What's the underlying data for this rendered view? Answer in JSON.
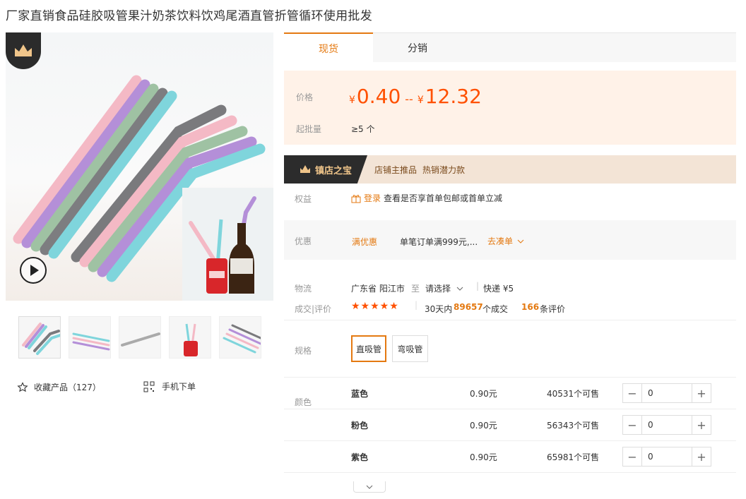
{
  "title": "厂家直销食品硅胶吸管果汁奶茶饮料饮鸡尾酒直管折管循环使用批发",
  "gallery": {
    "favorite_label": "收藏产品（127）",
    "mobile_label": "手机下单"
  },
  "tabs": [
    "现货",
    "分销"
  ],
  "price": {
    "label": "价格",
    "currency": "¥",
    "low": "0.40",
    "separator": "--",
    "high": "12.32",
    "moq_label": "起批量",
    "moq_value": "≥5 个"
  },
  "shop": {
    "badge": "镇店之宝",
    "tag1": "店铺主推品",
    "tag2": "热销潜力款"
  },
  "rights": {
    "label": "权益",
    "login": "登录",
    "text": "查看是否享首单包邮或首单立减"
  },
  "promo": {
    "label": "优惠",
    "tag": "满优惠",
    "text": "单笔订单满999元,...",
    "action": "去凑单"
  },
  "logistics": {
    "label": "物流",
    "from": "广东省 阳江市",
    "to_word": "至",
    "select": "请选择",
    "express": "快递 ¥5"
  },
  "deals": {
    "label": "成交|评价",
    "stars": "★★★★★",
    "days": "30天内",
    "count": "89657",
    "count_suffix": "个成交",
    "reviews": "166",
    "reviews_suffix": "条评价"
  },
  "spec": {
    "label": "规格",
    "options": [
      "直吸管",
      "弯吸管"
    ],
    "selected": "直吸管"
  },
  "colors": {
    "label": "颜色",
    "rows": [
      {
        "name": "蓝色",
        "price": "0.90元",
        "stock": "40531个可售",
        "qty": "0"
      },
      {
        "name": "粉色",
        "price": "0.90元",
        "stock": "56343个可售",
        "qty": "0"
      },
      {
        "name": "紫色",
        "price": "0.90元",
        "stock": "65981个可售",
        "qty": "0"
      }
    ]
  },
  "accent": "#e47911",
  "price_color": "#ff5000"
}
